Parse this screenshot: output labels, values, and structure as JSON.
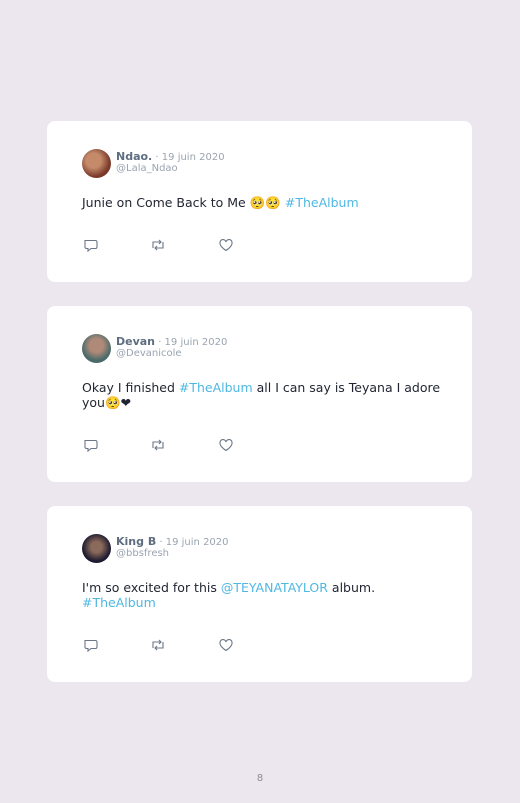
{
  "tweets": [
    {
      "name": "Ndao.",
      "date": " · 19 juin 2020",
      "handle": "@Lala_Ndao",
      "text_before": "Junie on Come Back to Me ",
      "emoji": "🥺🥺",
      "tag": "#TheAlbum",
      "avatar_colors": [
        "#7a3a2a",
        "#c48a6a"
      ]
    },
    {
      "name": "Devan",
      "date": " · 19 juin 2020",
      "handle": "@Devanicole",
      "text_before": "Okay I finished ",
      "tag": "#TheAlbum",
      "text_after": " all I can say is Teyana I adore you",
      "emoji": "🥺❤",
      "avatar_colors": [
        "#4a6a6a",
        "#b08a78"
      ]
    },
    {
      "name": "King B",
      "date": " · 19 juin 2020",
      "handle": "@bbsfresh",
      "text_before": "I'm so excited for this ",
      "mention": "@TEYANATAYLOR",
      "text_after": " album. ",
      "tag": "#TheAlbum",
      "avatar_colors": [
        "#1e1a30",
        "#8a6a5a"
      ]
    }
  ],
  "actions": [
    "reply-icon",
    "retweet-icon",
    "like-icon"
  ],
  "page_number": "8",
  "colors": {
    "background": "#ece7ee",
    "link": "#4fb7e2",
    "muted": "#9aa4b0"
  }
}
